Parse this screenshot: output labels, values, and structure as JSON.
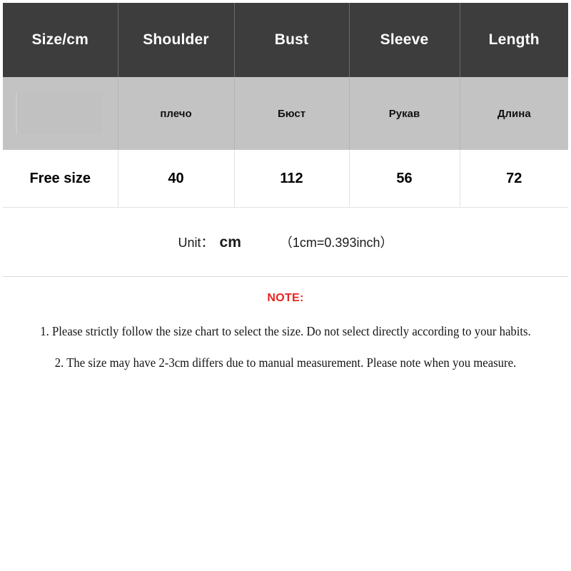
{
  "table": {
    "columns": [
      {
        "en": "Size",
        "unit_suffix": "/cm",
        "ru": "",
        "value": "Free size"
      },
      {
        "en": "Shoulder",
        "unit_suffix": "",
        "ru": "плечо",
        "value": "40"
      },
      {
        "en": "Bust",
        "unit_suffix": "",
        "ru": "Бюст",
        "value": "112"
      },
      {
        "en": "Sleeve",
        "unit_suffix": "",
        "ru": "Рукав",
        "value": "56"
      },
      {
        "en": "Length",
        "unit_suffix": "",
        "ru": "Длина",
        "value": "72"
      }
    ],
    "unit_row": {
      "label": "Unit：",
      "value": "cm",
      "conversion": "（1cm=0.393inch）"
    }
  },
  "note": {
    "title": "NOTE:",
    "lines": [
      "1. Please strictly follow the size chart to select the size. Do not select directly according to your habits.",
      "2. The size may have 2-3cm differs due to manual measurement. Please note when you measure."
    ]
  },
  "colors": {
    "header_background": "#3d3d3d",
    "header_text": "#ffffff",
    "translation_background": "#c3c3c3",
    "data_background": "#ffffff",
    "note_title": "#e8241f",
    "body_text": "#141414"
  }
}
